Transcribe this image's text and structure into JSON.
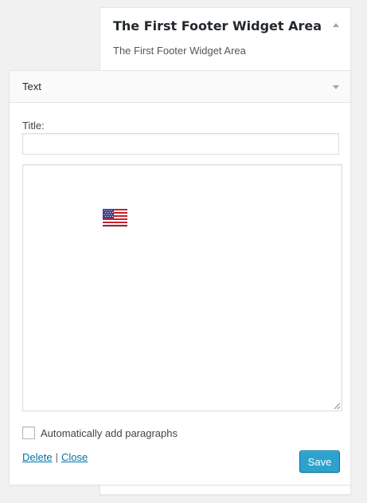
{
  "sidebar": {
    "title": "The First Footer Widget Area",
    "description": "The First Footer Widget Area",
    "toggle_icon": "arrow-up-icon"
  },
  "widget": {
    "title": "Text",
    "toggle_icon": "arrow-down-icon",
    "title_field": {
      "label": "Title:",
      "value": "",
      "placeholder": ""
    },
    "content_image": "us-flag-image",
    "autop": {
      "checked": false,
      "label": "Automatically add paragraphs"
    },
    "controls": {
      "delete_label": "Delete",
      "separator": "|",
      "close_label": "Close"
    },
    "save_label": "Save"
  },
  "colors": {
    "page_background": "#f1f1f1",
    "link": "#0073aa",
    "primary_button": "#2ea2cc",
    "primary_button_border": "#0074a2"
  }
}
